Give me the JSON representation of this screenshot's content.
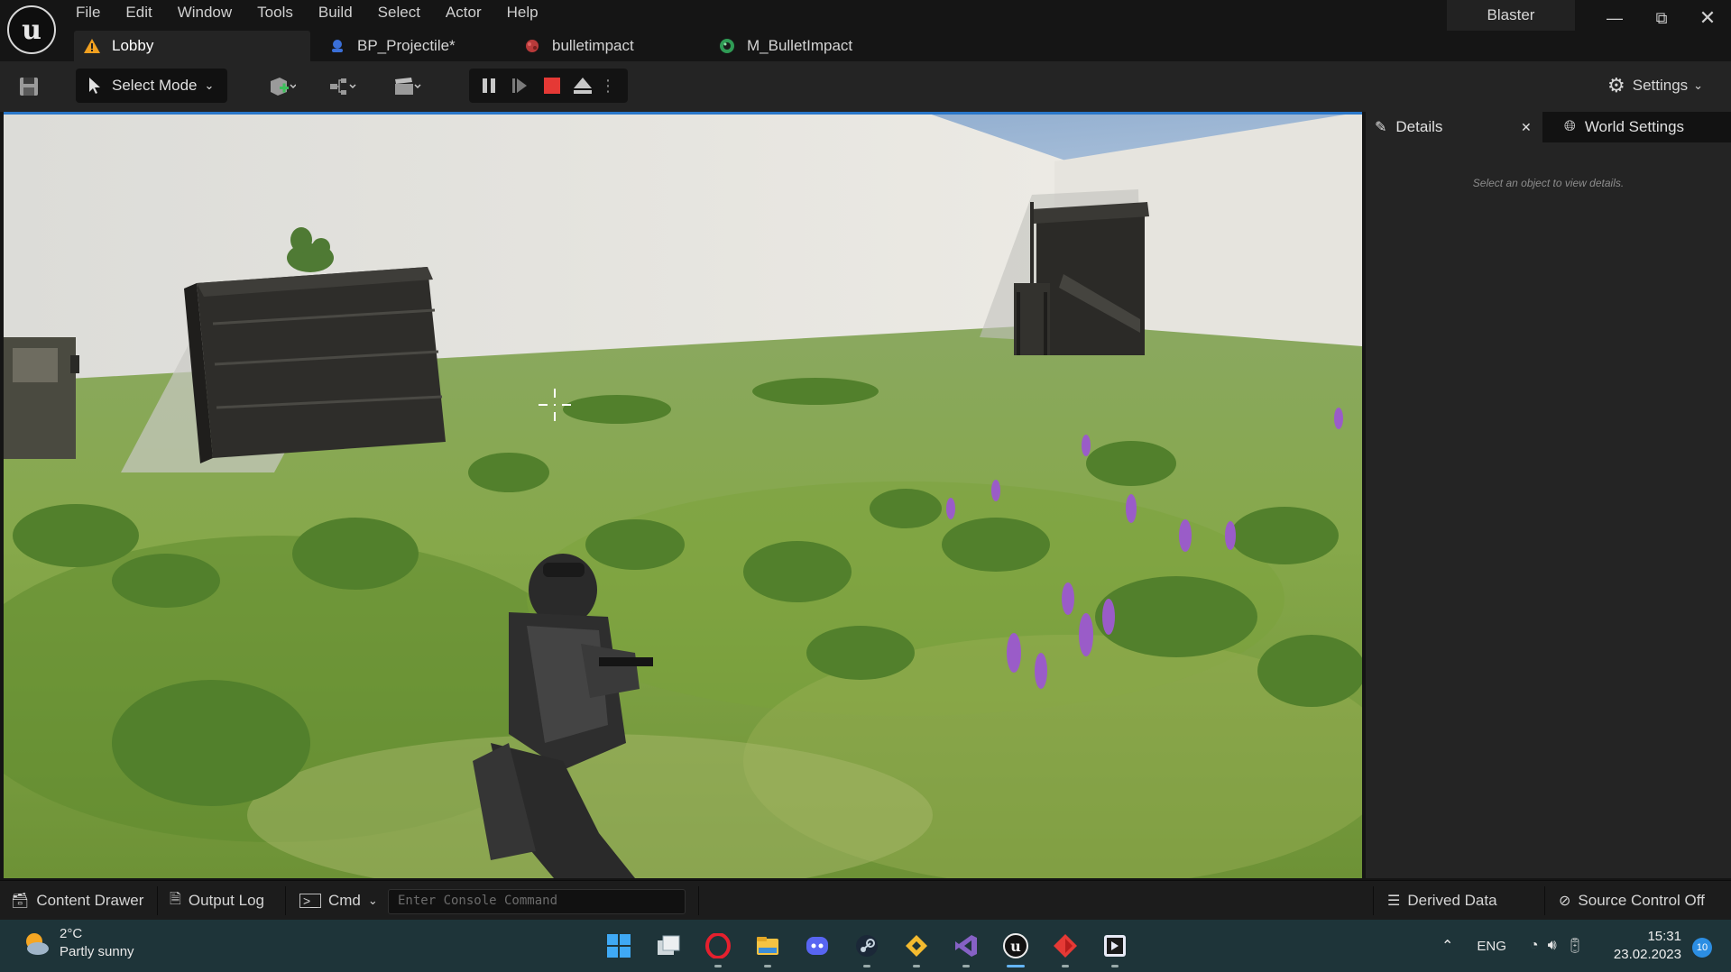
{
  "menu": {
    "items": [
      "File",
      "Edit",
      "Window",
      "Tools",
      "Build",
      "Select",
      "Actor",
      "Help"
    ]
  },
  "document_tabs": [
    {
      "label": "Lobby",
      "icon": "level-warning-icon",
      "active": true
    },
    {
      "label": "BP_Projectile*",
      "icon": "blueprint-icon",
      "active": false
    },
    {
      "label": "bulletimpact",
      "icon": "niagara-system-icon",
      "active": false
    },
    {
      "label": "M_BulletImpact",
      "icon": "material-icon",
      "active": false
    }
  ],
  "project_name": "Blaster",
  "toolbar": {
    "select_mode_label": "Select Mode",
    "settings_label": "Settings"
  },
  "details_panel": {
    "tabs": [
      {
        "label": "Details",
        "icon": "pencil-icon"
      },
      {
        "label": "World Settings",
        "icon": "globe-icon"
      }
    ],
    "empty_message": "Select an object to view details."
  },
  "status_bar": {
    "content_drawer": "Content Drawer",
    "output_log": "Output Log",
    "cmd": "Cmd",
    "console_placeholder": "Enter Console Command",
    "derived_data": "Derived Data",
    "source_control": "Source Control Off"
  },
  "taskbar": {
    "weather_temp": "2°C",
    "weather_desc": "Partly sunny",
    "language": "ENG",
    "time": "15:31",
    "date": "23.02.2023",
    "notifications": "10",
    "apps": [
      "windows-start",
      "task-view",
      "opera",
      "file-explorer",
      "discord",
      "steam",
      "binance",
      "visual-studio",
      "unreal-engine",
      "git",
      "rider"
    ]
  },
  "colors": {
    "accent_blue": "#2a77c9",
    "stop_red": "#e53935",
    "taskbar_bg": "#1e3439"
  }
}
